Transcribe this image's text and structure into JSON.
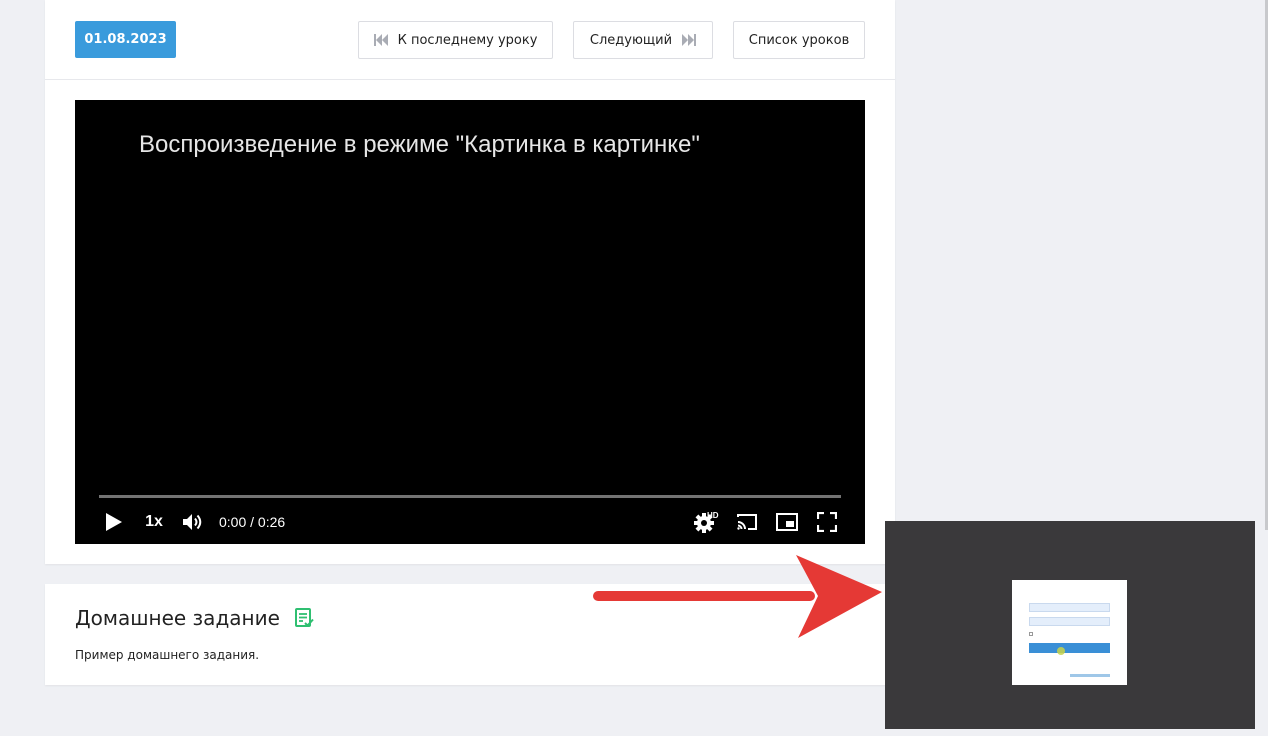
{
  "lesson": {
    "date": "01.08.2023",
    "buttons": {
      "last_lesson": "К последнему уроку",
      "next": "Следующий",
      "lesson_list": "Список уроков"
    }
  },
  "video": {
    "message": "Воспроизведение в режиме \"Картинка в картинке\"",
    "speed": "1x",
    "time": "0:00 / 0:26",
    "progress_fraction": 0.0,
    "quality_badge": "HD",
    "icons": [
      "play-icon",
      "volume-icon",
      "settings-hd-icon",
      "cast-icon",
      "miniplayer-icon",
      "fullscreen-icon"
    ]
  },
  "homework": {
    "title": "Домашнее задание",
    "text": "Пример домашнего задания.",
    "icon": "homework-doc-icon"
  },
  "colors": {
    "accent": "#3a9bdc",
    "homework_icon": "#2fbf71",
    "arrow": "#e53935",
    "pip_background": "#3a393b"
  }
}
